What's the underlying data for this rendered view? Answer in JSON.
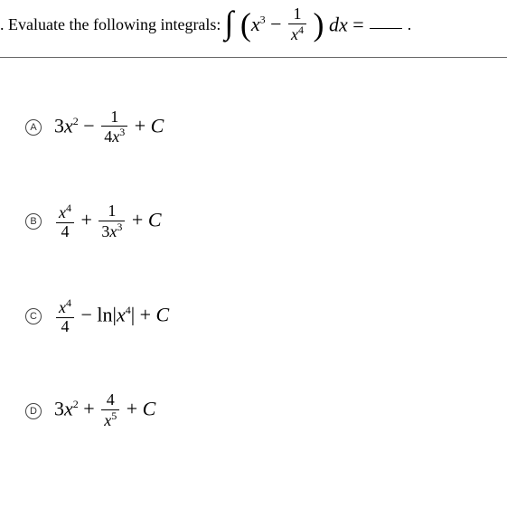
{
  "question": {
    "prefix": ". Evaluate the following integrals:",
    "integral_tex": "\\int\\left(x^{3}-\\frac{1}{x^{4}}\\right)dx=",
    "period": "."
  },
  "options": [
    {
      "letter": "A",
      "tex": "3x^{2}-\\frac{1}{4x^{3}}+C"
    },
    {
      "letter": "B",
      "tex": "\\frac{x^{4}}{4}+\\frac{1}{3x^{3}}+C"
    },
    {
      "letter": "C",
      "tex": "\\frac{x^{4}}{4}-\\ln|x^{4}|+C"
    },
    {
      "letter": "D",
      "tex": "3x^{2}+\\frac{4}{x^{5}}+C"
    }
  ]
}
